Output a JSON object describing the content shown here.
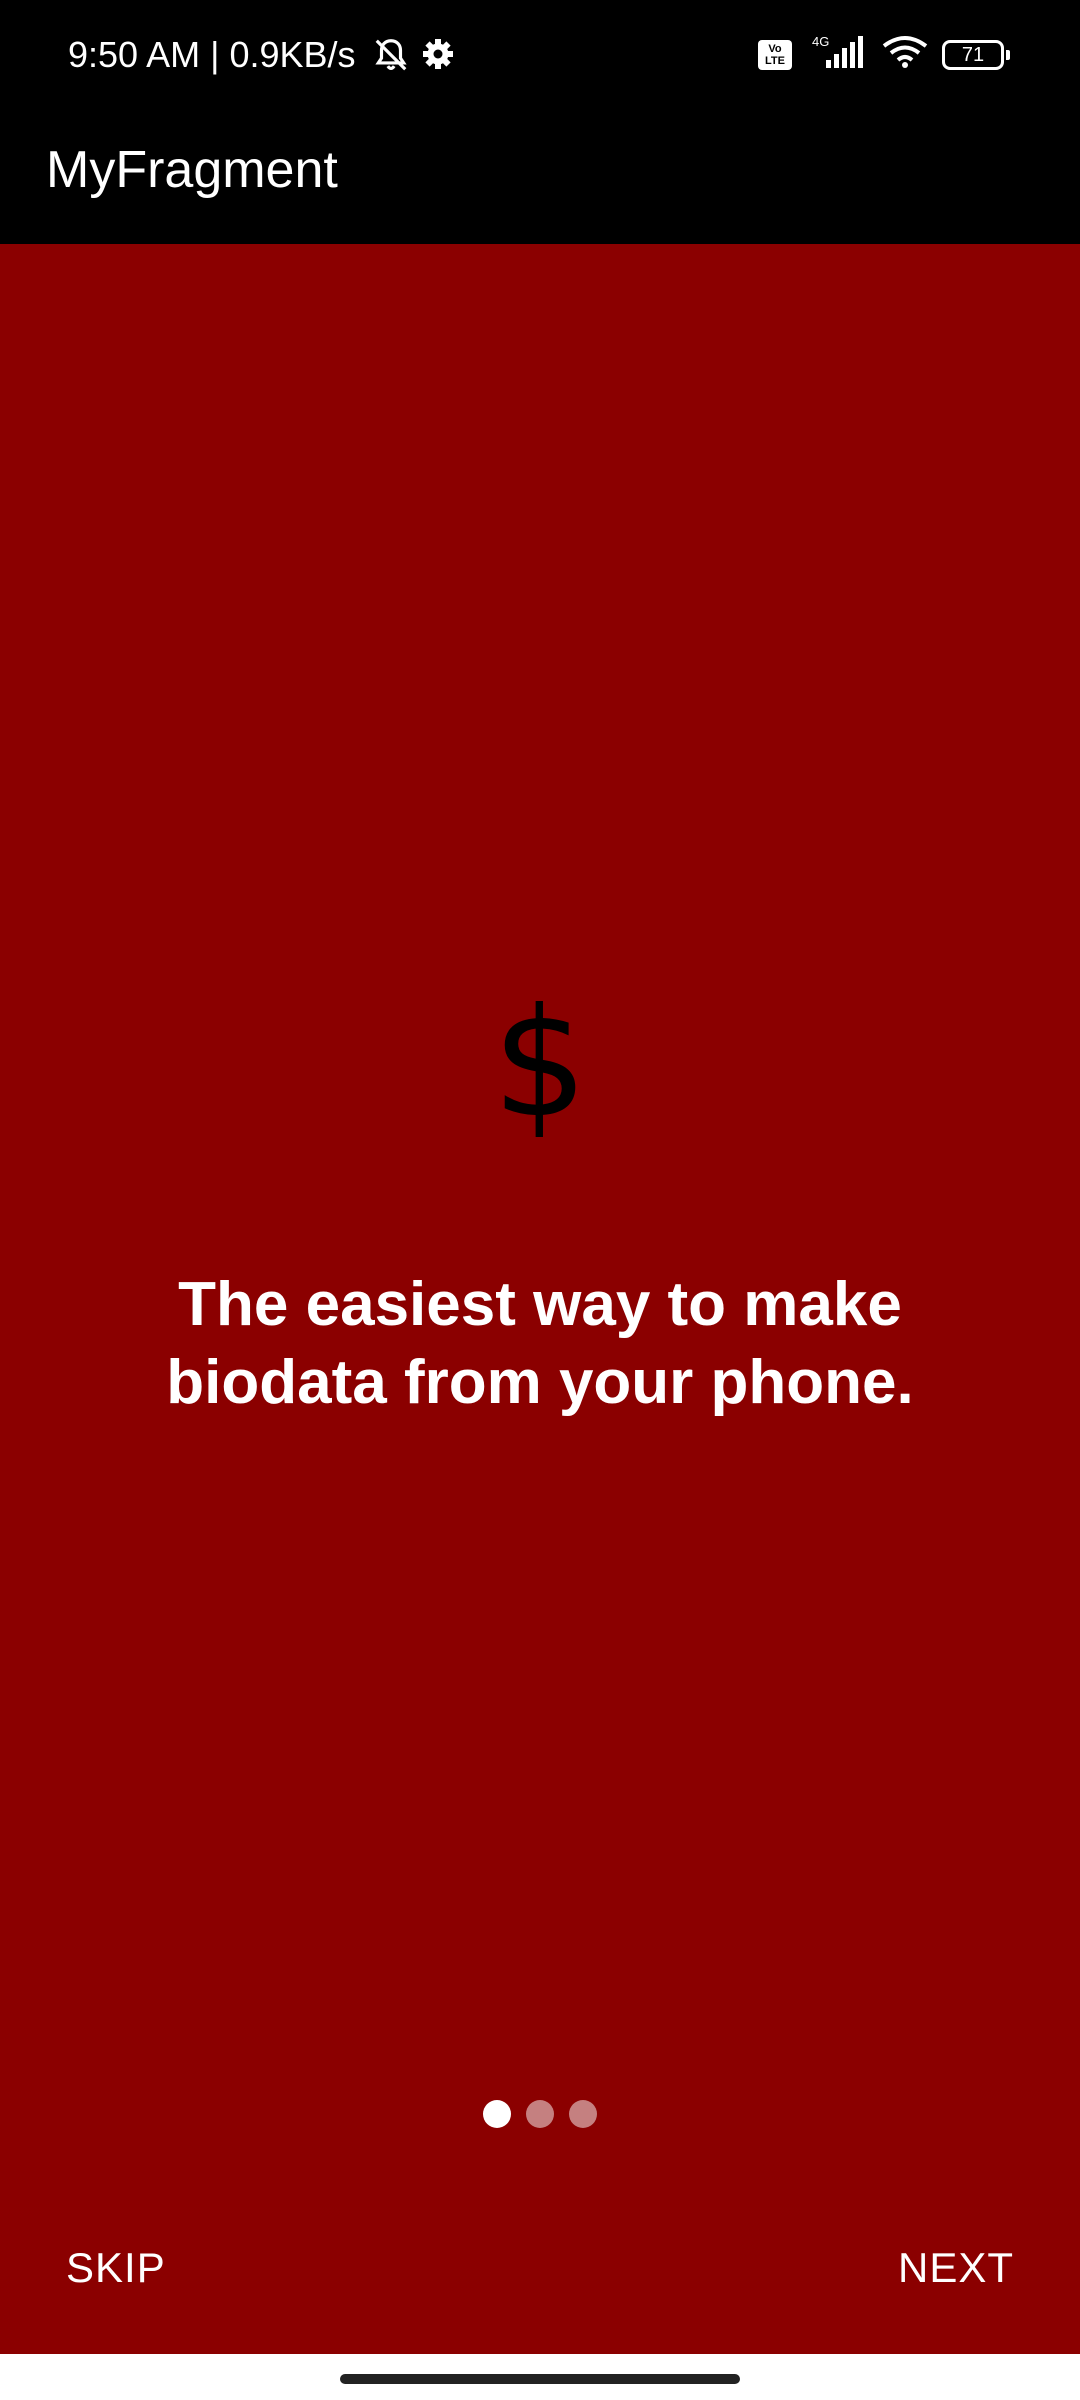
{
  "status_bar": {
    "time_text": "9:50 AM | 0.9KB/s",
    "icons": [
      "bell-off-icon",
      "gear-icon"
    ],
    "volte": "Vo LTE",
    "network": "4G",
    "battery": "71"
  },
  "app_bar": {
    "title": "MyFragment"
  },
  "slide": {
    "icon_glyph": "$",
    "icon_name": "dollar-icon",
    "text": "The easiest way to make biodata from your phone.",
    "page_count": 3,
    "current_page": 1
  },
  "actions": {
    "skip_label": "SKIP",
    "next_label": "NEXT"
  },
  "colors": {
    "background": "#8b0000",
    "bars": "#000000",
    "text": "#ffffff"
  }
}
